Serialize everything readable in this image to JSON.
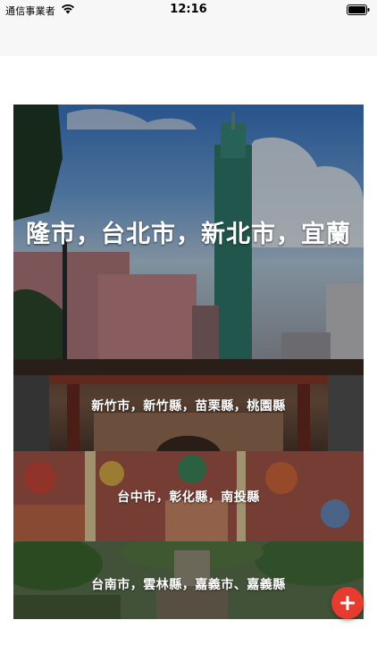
{
  "status_bar": {
    "carrier": "通信事業者",
    "time": "12:16",
    "wifi_icon": "wifi-icon",
    "battery_icon": "battery-icon"
  },
  "regions": [
    {
      "label": "隆市，台北市，新北市，宜蘭",
      "image": "taipei-101-skyline"
    },
    {
      "label": "新竹市，新竹縣，苗栗縣，桃園縣",
      "image": "temple-roof"
    },
    {
      "label": "台中市，彰化縣，南投縣",
      "image": "rainbow-village-mural"
    },
    {
      "label": "台南市，雲林縣，嘉義市、嘉義縣",
      "image": "park-trees"
    }
  ],
  "fab": {
    "icon": "plus-icon",
    "color": "#e63b2e"
  }
}
